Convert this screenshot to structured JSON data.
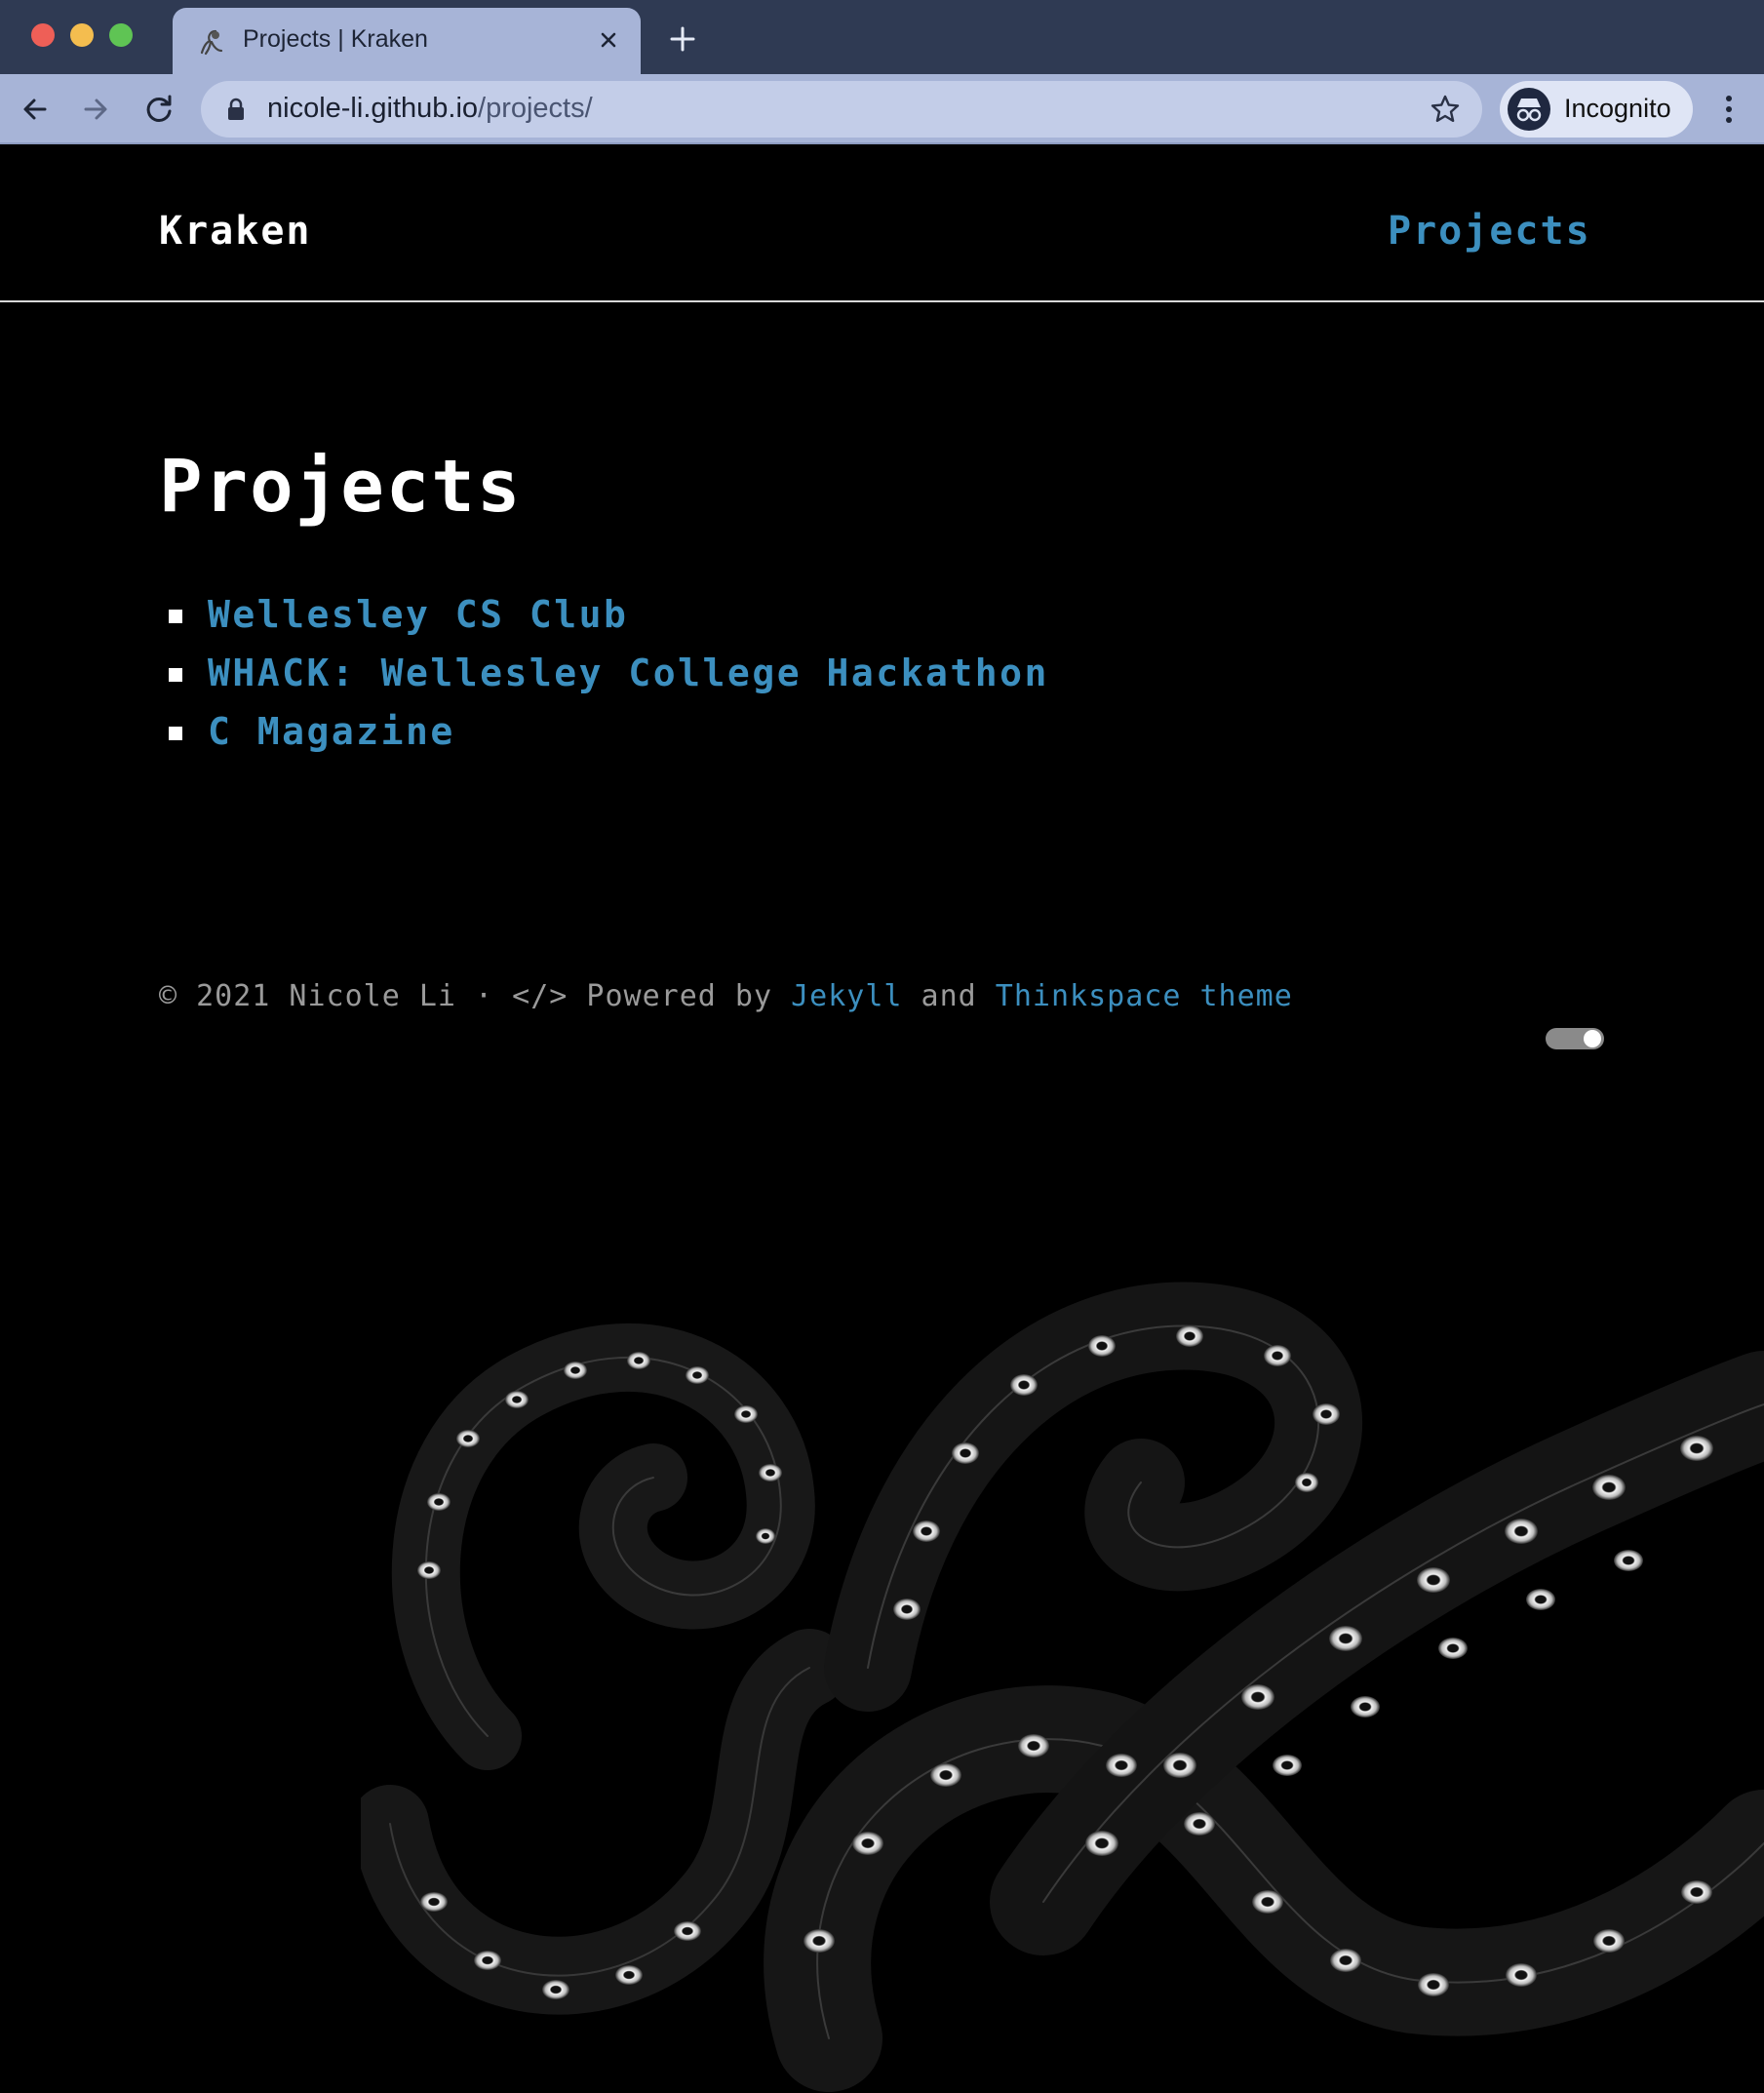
{
  "browser": {
    "tab_title": "Projects | Kraken",
    "url_domain": "nicole-li.github.io",
    "url_path": "/projects/",
    "profile_label": "Incognito",
    "icons": {
      "favicon": "kraken-favicon-icon",
      "close": "close-icon",
      "new_tab": "plus-icon",
      "back": "back-arrow-icon",
      "forward": "forward-arrow-icon",
      "reload": "reload-icon",
      "lock": "lock-icon",
      "bookmark": "star-icon",
      "incognito": "incognito-icon",
      "menu": "kebab-menu-icon"
    }
  },
  "site": {
    "title": "Kraken",
    "nav": [
      {
        "label": "Projects",
        "active": true
      }
    ]
  },
  "main": {
    "heading": "Projects",
    "projects": [
      {
        "label": "Wellesley CS Club"
      },
      {
        "label": "WHACK: Wellesley College Hackathon"
      },
      {
        "label": "C Magazine"
      }
    ]
  },
  "footer": {
    "copyright": "© 2021 Nicole Li · </> Powered by",
    "jekyll_label": "Jekyll",
    "and_text": "and",
    "theme_label": "Thinkspace theme"
  },
  "theme_toggle": {
    "state": "on"
  },
  "colors": {
    "link": "#3c8fbf",
    "background": "#000000",
    "chrome_tab": "#a7b4d7",
    "chrome_titlebar": "#2f3a53"
  }
}
